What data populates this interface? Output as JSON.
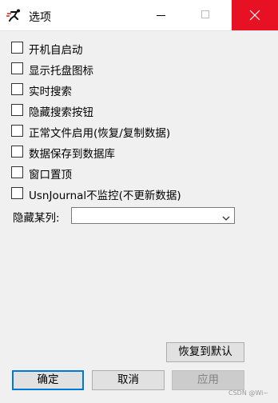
{
  "window": {
    "title": "选项",
    "icon": "runner-icon",
    "controls": {
      "minimize": "minimize-icon",
      "maximize": "maximize-icon",
      "close": "close-icon"
    },
    "close_color": "#e81123"
  },
  "options": [
    {
      "label": "开机自启动",
      "checked": false
    },
    {
      "label": "显示托盘图标",
      "checked": false
    },
    {
      "label": "实时搜索",
      "checked": false
    },
    {
      "label": "隐藏搜索按钮",
      "checked": false
    },
    {
      "label": "正常文件启用(恢复/复制数据)",
      "checked": false
    },
    {
      "label": "数据保存到数据库",
      "checked": false
    },
    {
      "label": "窗口置顶",
      "checked": false
    },
    {
      "label": "UsnJournal不监控(不更新数据)",
      "checked": false
    }
  ],
  "hide_column": {
    "label": "隐藏某列:",
    "value": ""
  },
  "buttons": {
    "restore_default": "恢复到默认",
    "ok": "确定",
    "cancel": "取消",
    "apply": "应用"
  },
  "accent_color": "#0078d7",
  "watermark": "CSDN @Wi~"
}
